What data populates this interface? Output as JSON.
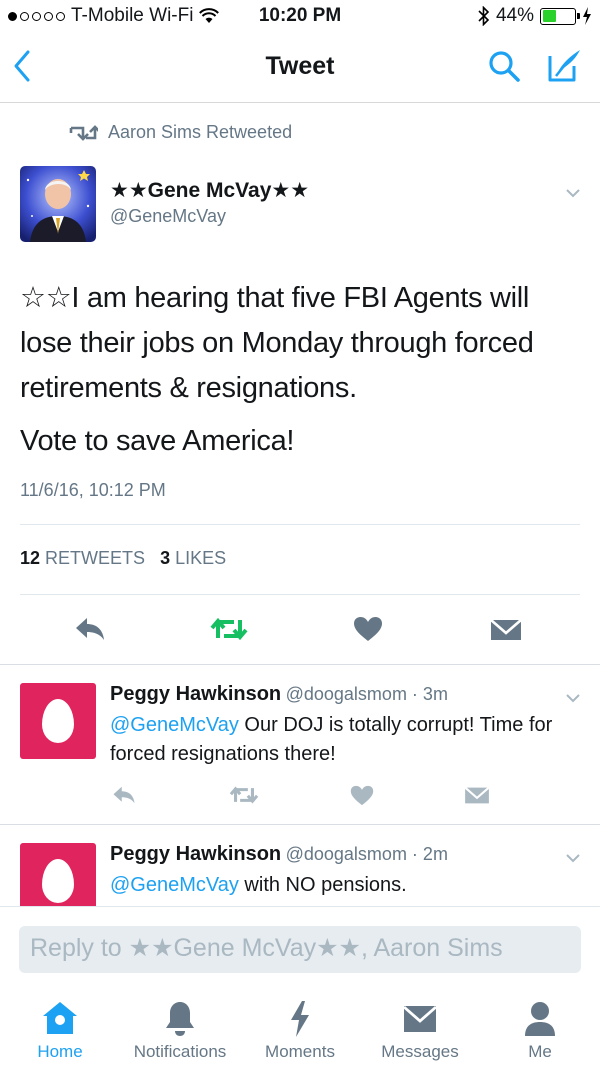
{
  "status_bar": {
    "carrier": "T-Mobile Wi-Fi",
    "time": "10:20 PM",
    "battery": "44%",
    "battery_level": 0.44
  },
  "nav": {
    "title": "Tweet"
  },
  "tweet": {
    "retweeted_by": "Aaron Sims Retweeted",
    "author_name": "★★Gene McVay★★",
    "author_handle": "@GeneMcVay",
    "text_1": "☆☆I am hearing that five FBI Agents will lose their jobs on Monday through forced retirements & resignations.",
    "text_2": "Vote to save America!",
    "timestamp": "11/6/16, 10:12 PM",
    "retweets_count": "12",
    "retweets_label": "RETWEETS",
    "likes_count": "3",
    "likes_label": "LIKES"
  },
  "replies": [
    {
      "name": "Peggy Hawkinson",
      "meta": "@doogalsmom · 3m",
      "mention": "@GeneMcVay",
      "text": " Our DOJ is totally corrupt! Time for forced resignations there!"
    },
    {
      "name": "Peggy Hawkinson",
      "meta": "@doogalsmom · 2m",
      "mention": "@GeneMcVay",
      "text": " with NO pensions."
    }
  ],
  "reply_box": {
    "placeholder": "Reply to ★★Gene McVay★★, Aaron Sims"
  },
  "tabs": [
    {
      "label": "Home",
      "icon": "home-icon"
    },
    {
      "label": "Notifications",
      "icon": "bell-icon"
    },
    {
      "label": "Moments",
      "icon": "lightning-icon"
    },
    {
      "label": "Messages",
      "icon": "envelope-icon"
    },
    {
      "label": "Me",
      "icon": "person-icon"
    }
  ],
  "colors": {
    "accent": "#1da1f2",
    "retweet_green": "#17bf63",
    "secondary_text": "#657786",
    "icon_gray": "#657786",
    "egg_bg": "#e0245e"
  }
}
